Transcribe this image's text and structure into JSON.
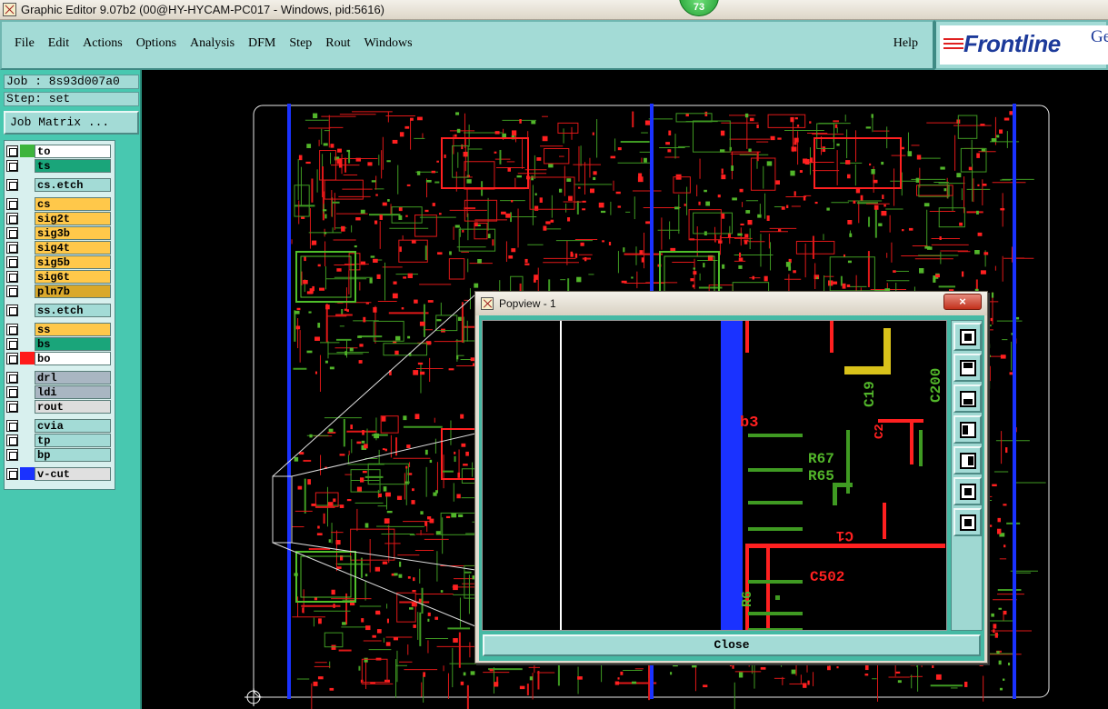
{
  "window": {
    "title": "Graphic Editor 9.07b2 (00@HY-HYCAM-PC017 - Windows, pid:5616)",
    "taskbar_badge": "73"
  },
  "menu": {
    "items": [
      "File",
      "Edit",
      "Actions",
      "Options",
      "Analysis",
      "DFM",
      "Step",
      "Rout",
      "Windows"
    ],
    "help": "Help"
  },
  "logo": {
    "text": "Frontline",
    "suffix": "Ge"
  },
  "job": {
    "job_label": "Job : 8s93d007a0",
    "step_label": "Step: set",
    "matrix_button": "Job Matrix ..."
  },
  "layers": [
    {
      "name": "to",
      "swatch": "#3cb43c",
      "label_bg": "#ffffff"
    },
    {
      "name": "ts",
      "swatch": "",
      "label_bg": "#1aa57a"
    },
    {
      "name": "cs.etch",
      "swatch": "",
      "label_bg": "#a3dbd6"
    },
    {
      "name": "cs",
      "swatch": "",
      "label_bg": "#ffc84a"
    },
    {
      "name": "sig2t",
      "swatch": "",
      "label_bg": "#ffc84a"
    },
    {
      "name": "sig3b",
      "swatch": "",
      "label_bg": "#ffc84a"
    },
    {
      "name": "sig4t",
      "swatch": "",
      "label_bg": "#ffc84a"
    },
    {
      "name": "sig5b",
      "swatch": "",
      "label_bg": "#ffc84a"
    },
    {
      "name": "sig6t",
      "swatch": "",
      "label_bg": "#ffc84a"
    },
    {
      "name": "pln7b",
      "swatch": "",
      "label_bg": "#d9a82a"
    },
    {
      "name": "ss.etch",
      "swatch": "",
      "label_bg": "#a3dbd6"
    },
    {
      "name": "ss",
      "swatch": "",
      "label_bg": "#ffc84a"
    },
    {
      "name": "bs",
      "swatch": "",
      "label_bg": "#1aa57a"
    },
    {
      "name": "bo",
      "swatch": "#ff1a1a",
      "label_bg": "#ffffff"
    },
    {
      "name": "drl",
      "swatch": "",
      "label_bg": "#a9b6c2"
    },
    {
      "name": "ldi",
      "swatch": "",
      "label_bg": "#a9b6c2"
    },
    {
      "name": "rout",
      "swatch": "",
      "label_bg": "#dddddd"
    },
    {
      "name": "cvia",
      "swatch": "",
      "label_bg": "#a3dbd6"
    },
    {
      "name": "tp",
      "swatch": "",
      "label_bg": "#a3dbd6"
    },
    {
      "name": "bp",
      "swatch": "",
      "label_bg": "#a3dbd6"
    },
    {
      "name": "v-cut",
      "swatch": "#1a32ff",
      "label_bg": "#e0e0e0"
    }
  ],
  "popview": {
    "title": "Popview - 1",
    "close_button": "Close",
    "close_x": "×",
    "refdes": [
      "b3",
      "R67",
      "R65",
      "C19",
      "C200",
      "C2",
      "C502",
      "C1",
      "R6"
    ]
  }
}
